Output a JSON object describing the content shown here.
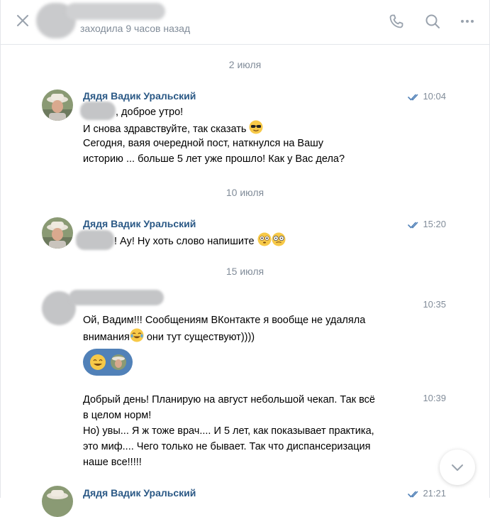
{
  "header": {
    "status": "заходила 9 часов назад"
  },
  "dates": [
    "2 июля",
    "10 июля",
    "15 июля"
  ],
  "messages": [
    {
      "author": "Дядя Вадик Уральский",
      "time": "10:04",
      "lines": [
        ", доброе утро!",
        "И снова здравствуйте, так сказать",
        "Сегодня, ваяя очередной пост, наткнулся на Вашу",
        "историю ... больше 5 лет уже прошло! Как у Вас дела?"
      ]
    },
    {
      "author": "Дядя Вадик Уральский",
      "time": "15:20",
      "lines": [
        "! Ау! Ну хоть слово напишите"
      ]
    },
    {
      "time": "10:35",
      "lines": [
        "Ой, Вадим!!! Сообщениям ВКонтакте я вообще не удаляла",
        "внимания",
        " они тут существуют))))"
      ]
    },
    {
      "time": "10:39",
      "lines": [
        "Добрый день! Планирую на август небольшой чекап. Так всё",
        "в целом норм!",
        "Но) увы... Я ж тоже врач.... И 5 лет, как показывает практика,",
        "это миф.... Чего только не бывает. Так что диспансеризация",
        "наше все!!!!!"
      ]
    },
    {
      "author": "Дядя Вадик Уральский",
      "time": "21:21"
    }
  ],
  "icons": {
    "close": "close-icon",
    "phone": "phone-icon",
    "search": "search-icon",
    "more": "more-icon",
    "read": "read-check-icon",
    "scroll": "chevron-down-icon"
  },
  "colors": {
    "author": "#2a5885",
    "muted": "#818c99",
    "icon": "#99a2ad",
    "sticker_bg": "#5181b8"
  }
}
